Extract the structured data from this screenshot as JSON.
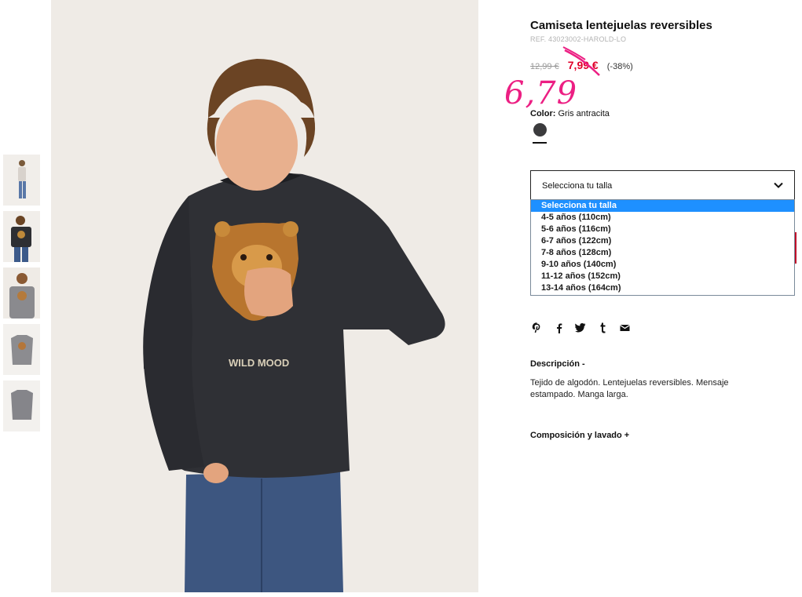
{
  "product": {
    "title": "Camiseta lentejuelas reversibles",
    "ref": "REF. 43023002-HAROLD-LO",
    "old_price": "12,99 €",
    "sale_price": "7,99 €",
    "discount": "(-38%)",
    "handwritten_price": "6,79",
    "color_label": "Color:",
    "color_value": "Gris antracita",
    "swatch_color": "#3b3b3d",
    "sale_color": "#e0002a",
    "annotation_color": "#ec1f83"
  },
  "photo": {
    "shirt_text": "WILD MOOD"
  },
  "size_select": {
    "label": "Selecciona tu talla",
    "options": [
      "Selecciona tu talla",
      "4-5 años (110cm)",
      "5-6 años (116cm)",
      "6-7 años (122cm)",
      "7-8 años (128cm)",
      "9-10 años (140cm)",
      "11-12 años (152cm)",
      "13-14 años (164cm)"
    ],
    "selected_index": 0
  },
  "share": {
    "icons": [
      "pinterest-icon",
      "facebook-icon",
      "twitter-icon",
      "tumblr-icon",
      "email-icon"
    ]
  },
  "description": {
    "heading": "Descripción -",
    "text": "Tejido de algodón. Lentejuelas reversibles. Mensaje estampado. Manga larga."
  },
  "composition": {
    "heading": "Composición y lavado +"
  }
}
